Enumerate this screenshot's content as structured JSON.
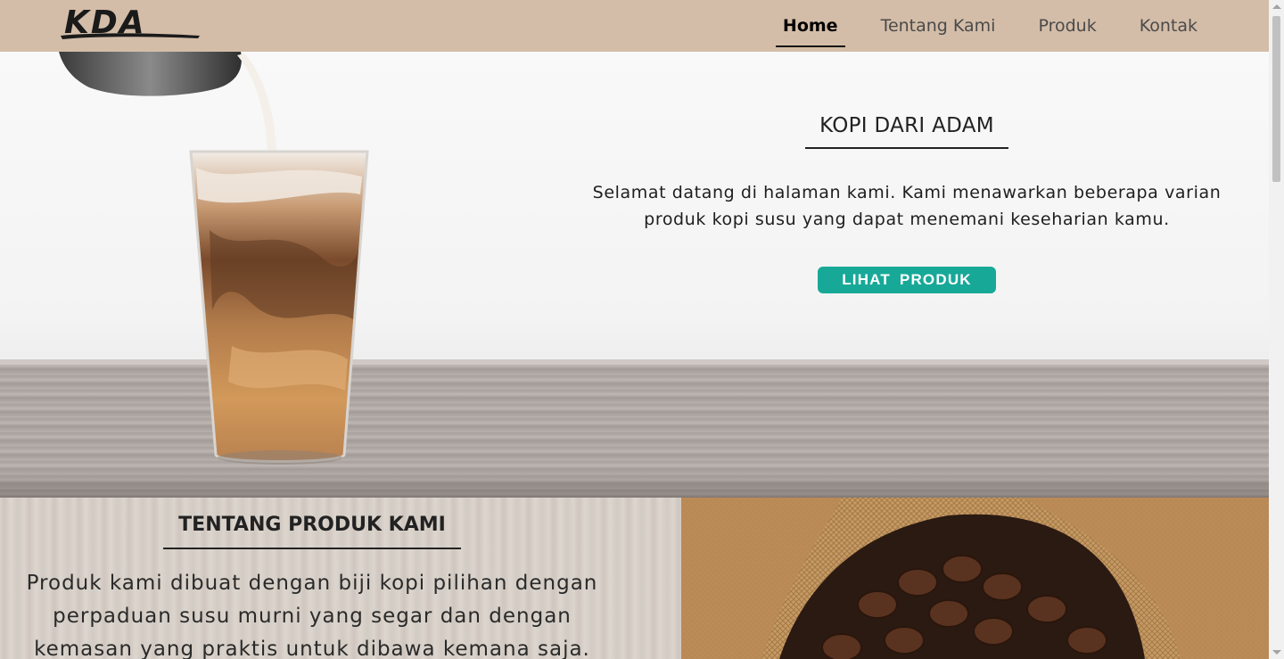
{
  "brand": {
    "logo_text": "KDA"
  },
  "nav": {
    "items": [
      {
        "label": "Home",
        "active": true
      },
      {
        "label": "Tentang Kami",
        "active": false
      },
      {
        "label": "Produk",
        "active": false
      },
      {
        "label": "Kontak",
        "active": false
      }
    ]
  },
  "hero": {
    "title": "KOPI DARI ADAM",
    "description_line1": "Selamat datang di halaman kami. Kami menawarkan beberapa varian",
    "description_line2": "produk kopi susu yang dapat menemani keseharian kamu.",
    "button_label": "LIHAT PRODUK",
    "image_icon": "iced-coffee-image"
  },
  "about": {
    "title": "TENTANG PRODUK KAMI",
    "text_line1": "Produk kami dibuat dengan biji kopi pilihan dengan",
    "text_line2": "perpaduan susu murni yang segar dan dengan",
    "text_line3": "kemasan yang praktis untuk dibawa kemana saja.",
    "image_icon": "coffee-beans-sack-image"
  },
  "colors": {
    "navbar": "#d4bda8",
    "accent_button": "#18a898",
    "text_dark": "#222222"
  }
}
